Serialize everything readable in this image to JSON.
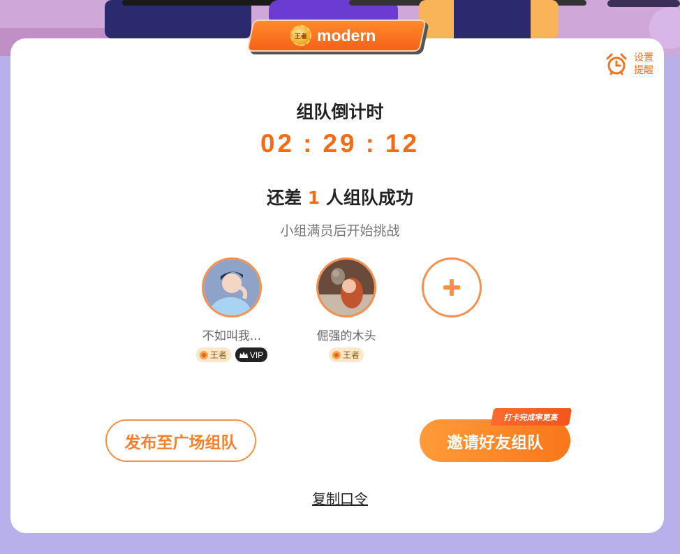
{
  "badge": {
    "text": "modern",
    "medal_text": "王者"
  },
  "reminder": {
    "label": "设置提醒"
  },
  "countdown": {
    "title": "组队倒计时",
    "hours": "02",
    "minutes": "29",
    "seconds": "12",
    "separator": ":"
  },
  "team_status": {
    "prefix": "还差",
    "remaining": "1",
    "suffix": "人组队成功",
    "subtitle": "小组满员后开始挑战"
  },
  "members": [
    {
      "name": "不如叫我...",
      "tags": [
        "王者",
        "VIP"
      ]
    },
    {
      "name": "倔强的木头",
      "tags": [
        "王者"
      ]
    }
  ],
  "buttons": {
    "publish": "发布至广场组队",
    "invite": "邀请好友组队",
    "invite_hint": "打卡完成率更高",
    "copy": "复制口令"
  },
  "colors": {
    "accent": "#f76b12",
    "page_bg": "#b7b0ea"
  },
  "icons": {
    "alarm": "alarm-clock-icon",
    "add": "plus-icon",
    "medal": "medal-icon",
    "crown": "crown-icon"
  }
}
